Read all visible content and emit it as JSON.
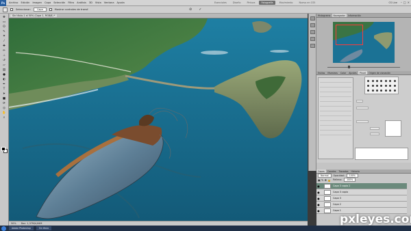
{
  "app": {
    "logo": "Ps"
  },
  "menu": {
    "items": [
      "Archivo",
      "Edición",
      "Imagen",
      "Capa",
      "Selección",
      "Filtro",
      "Análisis",
      "3D",
      "Vista",
      "Ventana",
      "Ayuda"
    ]
  },
  "workspace": {
    "buttons": [
      "Esenciales",
      "Diseño",
      "Pintura",
      "Fotografía",
      "Movimiento",
      "Nuevo en CS5"
    ],
    "active_index": 3,
    "cs_live": "CS Live"
  },
  "options": {
    "label": "Seleccionar:",
    "select_value": "Capa",
    "checkbox_label": "Mostrar controles de transf."
  },
  "document": {
    "tab_label": "Sin título-1 al 50% (Capa 1, RGB/8) *",
    "zoom": "50%",
    "doc_info": "Doc: 1,37M/4,84M"
  },
  "panels": {
    "nav_tabs": [
      "Histograma",
      "Navegador",
      "Información"
    ],
    "nav_active": 1,
    "style_tabs": [
      "Estilos",
      "Muestras",
      "Color",
      "Ajustes",
      "Pincel",
      "Origen de clonación"
    ],
    "style_active": 4,
    "layers_tabs": [
      "Capas",
      "Canales",
      "Trazados",
      "Historia"
    ],
    "layers_active": 0,
    "blend_mode": "Normal",
    "opacity_label": "Opacidad:",
    "opacity": "100%",
    "fill_label": "Relleno:",
    "fill": "100%",
    "layers": [
      {
        "name": "Capa 3 copia 2",
        "selected": true
      },
      {
        "name": "Capa 3 copia",
        "selected": false
      },
      {
        "name": "Capa 3",
        "selected": false
      },
      {
        "name": "Capa 2",
        "selected": false
      },
      {
        "name": "Capa 1",
        "selected": false
      }
    ]
  },
  "taskbar": {
    "items": [
      "Adobe Photoshop",
      "Sin título"
    ]
  },
  "watermark": "pxleyes.com",
  "colors": {
    "accent": "#6b8a7c",
    "sea": "#1a6d8c",
    "land": "#3c7a45",
    "insect": "#7a4c2e"
  }
}
